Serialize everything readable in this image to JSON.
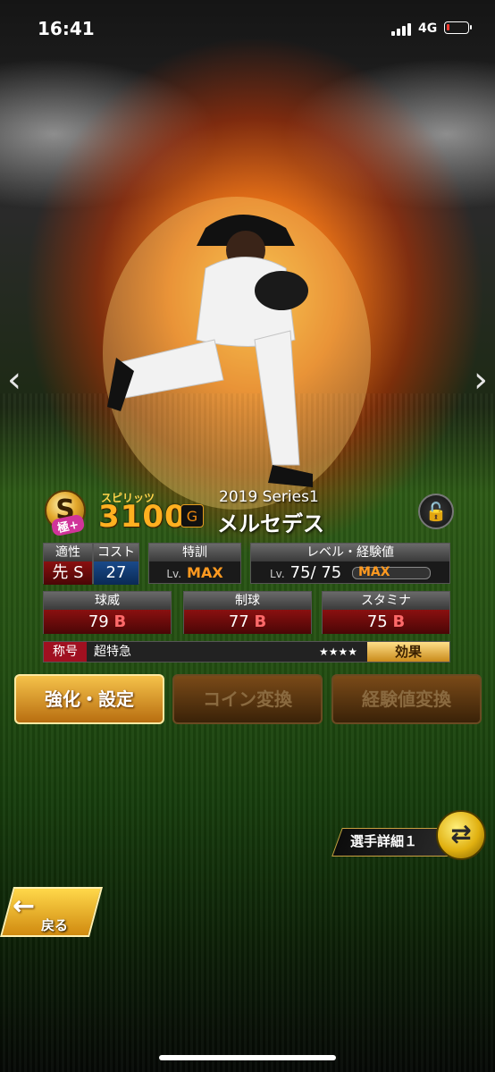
{
  "status_bar": {
    "time": "16:41",
    "network": "4G"
  },
  "card": {
    "rank_letter": "S",
    "rank_tag": "極+",
    "spirits_label": "スピリッツ",
    "spirits_value": "3100",
    "team_logo": "G",
    "series": "2019 Series1",
    "player_name": "メルセデス"
  },
  "stats": {
    "aptitude": {
      "label": "適性",
      "value": "先",
      "grade": "S"
    },
    "cost": {
      "label": "コスト",
      "value": "27"
    },
    "training": {
      "label": "特訓",
      "lv_label": "Lv.",
      "value": "MAX"
    },
    "level": {
      "label": "レベル・経験値",
      "lv_label": "Lv.",
      "value": "75/ 75",
      "exp_label": "MAX"
    },
    "velocity": {
      "label": "球威",
      "value": "79",
      "grade": "B"
    },
    "control": {
      "label": "制球",
      "value": "77",
      "grade": "B"
    },
    "stamina": {
      "label": "スタミナ",
      "value": "75",
      "grade": "B"
    }
  },
  "title": {
    "label": "称号",
    "value": "超特急",
    "stars": "★★★★",
    "effect_button": "効果"
  },
  "actions": {
    "enhance": "強化・設定",
    "coin": "コイン変換",
    "exp": "経験値変換"
  },
  "detail": {
    "label": "選手詳細１"
  },
  "back": {
    "label": "戻る"
  },
  "icons": [
    "chevron-left-icon",
    "chevron-right-icon",
    "lock-icon",
    "swap-icon",
    "back-arrow-icon"
  ]
}
